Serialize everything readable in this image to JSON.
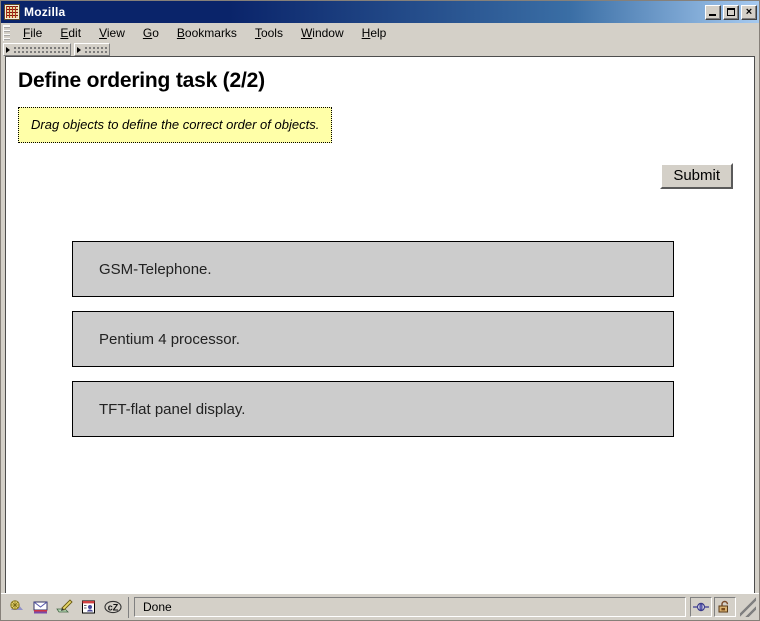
{
  "window": {
    "title": "Mozilla",
    "icon": "mozilla-icon",
    "minimize_label": "",
    "maximize_label": "",
    "close_label": "×"
  },
  "menubar": {
    "items": [
      {
        "label": "File",
        "accel": "F"
      },
      {
        "label": "Edit",
        "accel": "E"
      },
      {
        "label": "View",
        "accel": "V"
      },
      {
        "label": "Go",
        "accel": "G"
      },
      {
        "label": "Bookmarks",
        "accel": "B"
      },
      {
        "label": "Tools",
        "accel": "T"
      },
      {
        "label": "Window",
        "accel": "W"
      },
      {
        "label": "Help",
        "accel": "H"
      }
    ]
  },
  "page": {
    "title": "Define ordering task (2/2)",
    "hint": "Drag objects to define the correct order of objects.",
    "submit_label": "Submit",
    "items": [
      {
        "label": "GSM-Telephone."
      },
      {
        "label": "Pentium 4 processor."
      },
      {
        "label": "TFT-flat panel display."
      }
    ]
  },
  "statusbar": {
    "status_text": "Done",
    "icons": [
      "browser-icon",
      "mail-icon",
      "composer-icon",
      "address-book-icon",
      "chatzilla-icon"
    ],
    "chatzilla_label": "cZ",
    "connection_icon": "connection-icon",
    "security_icon": "unlocked-padlock-icon"
  },
  "colors": {
    "titlebar_start": "#0a246a",
    "titlebar_end": "#a6caf0",
    "chrome": "#d4d0c8",
    "hint_bg": "#ffffa8",
    "item_bg": "#cccccc",
    "page_bg": "#ffffff"
  }
}
